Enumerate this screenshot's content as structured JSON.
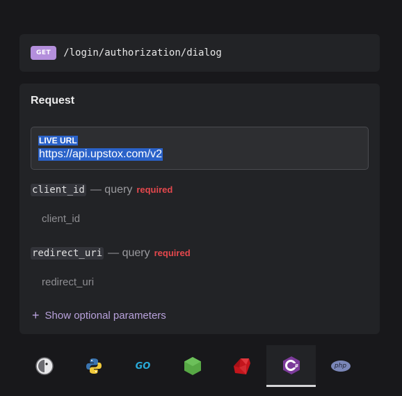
{
  "endpoint": {
    "method": "GET",
    "path": "/login/authorization/dialog"
  },
  "request": {
    "title": "Request",
    "live_url": {
      "label": "LIVE URL",
      "value": "https://api.upstox.com/v2"
    },
    "params": [
      {
        "name": "client_id",
        "type": "— query",
        "required": "required",
        "placeholder": "client_id"
      },
      {
        "name": "redirect_uri",
        "type": "— query",
        "required": "required",
        "placeholder": "redirect_uri"
      }
    ],
    "optional_toggle": "Show optional parameters"
  },
  "languages": {
    "items": [
      {
        "icon": "curl-icon"
      },
      {
        "icon": "python-icon"
      },
      {
        "icon": "go-icon",
        "text": "GO"
      },
      {
        "icon": "nodejs-icon"
      },
      {
        "icon": "ruby-icon"
      },
      {
        "icon": "csharp-icon",
        "active": true
      },
      {
        "icon": "php-icon",
        "text": "php"
      }
    ]
  },
  "colors": {
    "background": "#18181b",
    "panel": "#222326",
    "method_badge": "#b48fdc",
    "required": "#e5484d",
    "accent": "#b9a2dc"
  }
}
